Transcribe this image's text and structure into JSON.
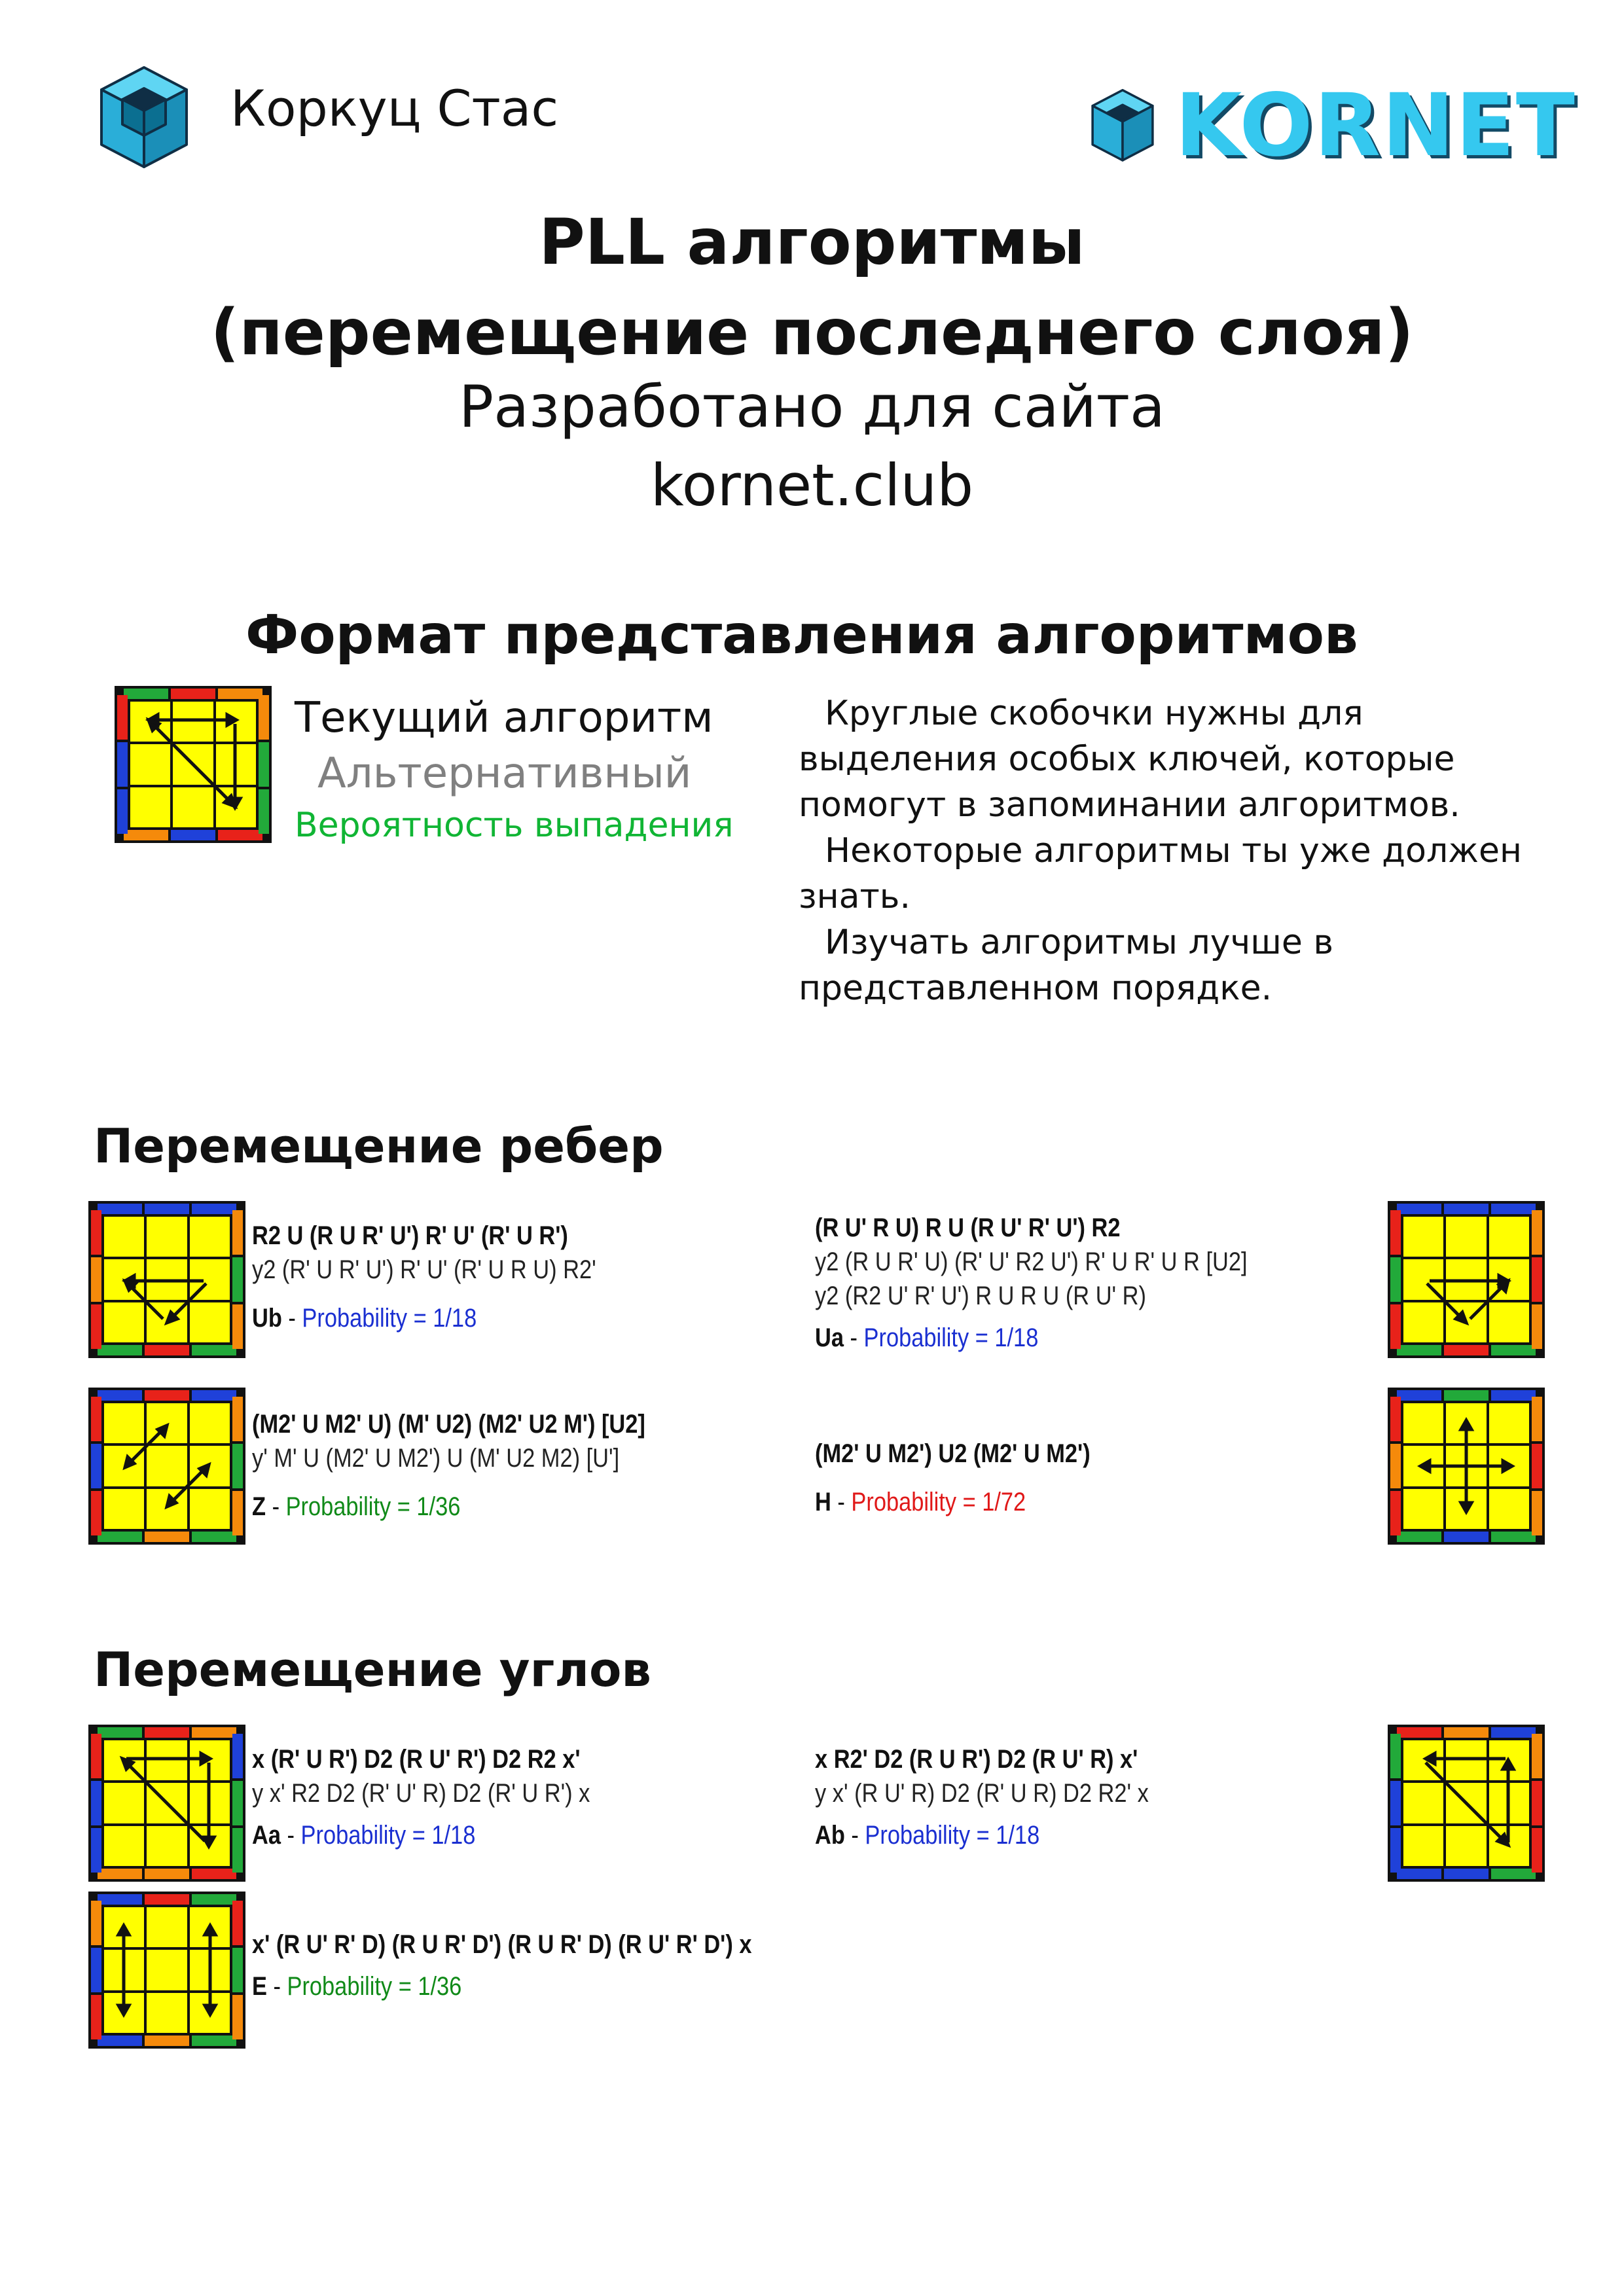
{
  "header": {
    "author": "Коркуц Стас",
    "brand": "KORNET",
    "title_line1": "PLL алгоритмы",
    "title_line2": "(перемещение последнего слоя)",
    "subtitle_line1": "Разработано для сайта",
    "subtitle_line2": "kornet.club"
  },
  "format": {
    "title": "Формат представления алгоритмов",
    "legend_current": "Текущий алгоритм",
    "legend_alt": "Альтернативный",
    "legend_prob": "Вероятность выпадения",
    "notes": [
      "Круглые скобочки нужны для выделения особых ключей, которые помогут в запоминании алгоритмов.",
      "Некоторые алгоритмы ты уже должен знать.",
      "Изучать алгоритмы лучше в представленном порядке."
    ]
  },
  "sections": {
    "edges": "Перемещение ребер",
    "corners": "Перемещение углов"
  },
  "algorithms": {
    "ub": {
      "main": "R2 U (R U R' U') R' U' (R' U R')",
      "alts": [
        "y2 (R' U R' U') R' U' (R' U R U) R2'"
      ],
      "name": "Ub",
      "prob": "Probability = 1/18",
      "prob_color": "#1a2fd1"
    },
    "ua": {
      "main": "(R U' R U) R U (R U' R' U') R2",
      "alts": [
        "y2 (R U R' U) (R' U' R2 U') R' U R' U R [U2]",
        "y2 (R2 U' R' U') R U R U (R U' R)"
      ],
      "name": "Ua",
      "prob": "Probability = 1/18",
      "prob_color": "#1a2fd1"
    },
    "z": {
      "main": "(M2' U M2' U) (M' U2) (M2' U2 M') [U2]",
      "alts": [
        "y' M' U (M2' U M2') U (M' U2 M2) [U']"
      ],
      "name": "Z",
      "prob": "Probability = 1/36",
      "prob_color": "#108a18"
    },
    "h": {
      "main": "(M2' U M2') U2 (M2' U M2')",
      "alts": [],
      "name": "H",
      "prob": "Probability = 1/72",
      "prob_color": "#e01818"
    },
    "aa": {
      "main": "x (R' U R') D2 (R U' R') D2 R2 x'",
      "alts": [
        "y x' R2 D2 (R' U' R) D2 (R' U R') x"
      ],
      "name": "Aa",
      "prob": "Probability = 1/18",
      "prob_color": "#1a2fd1"
    },
    "ab": {
      "main": "x R2' D2 (R U R') D2 (R U' R) x'",
      "alts": [
        "y x' (R U' R) D2 (R' U R) D2 R2' x"
      ],
      "name": "Ab",
      "prob": "Probability = 1/18",
      "prob_color": "#1a2fd1"
    },
    "e": {
      "main": "x' (R U' R' D) (R U R' D') (R U R' D) (R U' R' D') x",
      "alts": [],
      "name": "E",
      "prob": "Probability = 1/36",
      "prob_color": "#108a18"
    }
  },
  "colors": {
    "yellow": "#ffff00",
    "red": "#e8221a",
    "orange": "#f58a0b",
    "green": "#22a93a",
    "blue": "#1f41d9",
    "accent": "#35c8ef"
  }
}
